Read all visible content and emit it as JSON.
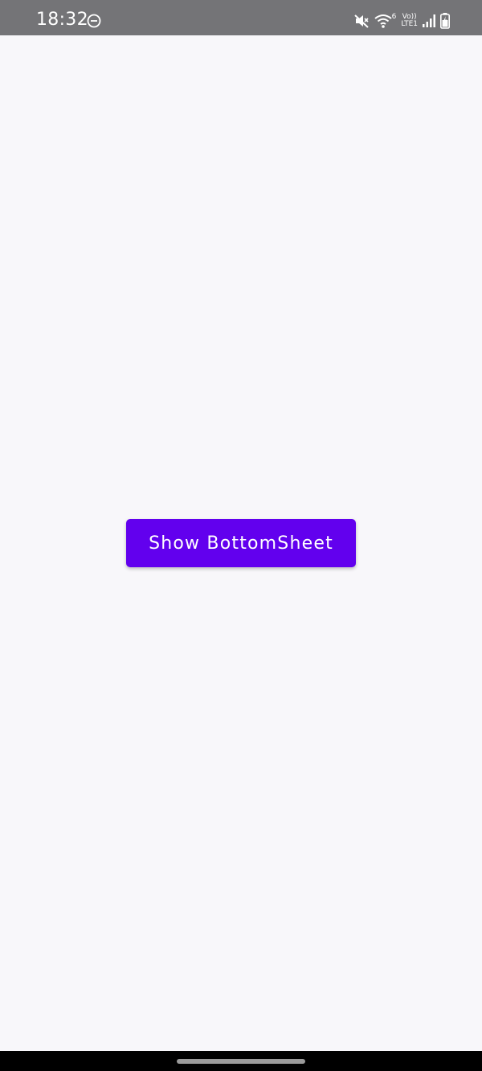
{
  "status_bar": {
    "time": "18:32",
    "network_label_top": "Vo))",
    "network_label_bottom": "LTE1",
    "signal_sup": "6",
    "background": "#747477",
    "icons": [
      "do-not-disturb-icon",
      "mute-icon",
      "wifi-icon",
      "volte-icon",
      "signal-icon",
      "battery-icon"
    ]
  },
  "main": {
    "button_label": "Show BottomSheet",
    "button_color": "#6200ee",
    "background": "#f8f7fa"
  },
  "nav_bar": {
    "background": "#000000",
    "icons": [
      "home-handle"
    ]
  }
}
